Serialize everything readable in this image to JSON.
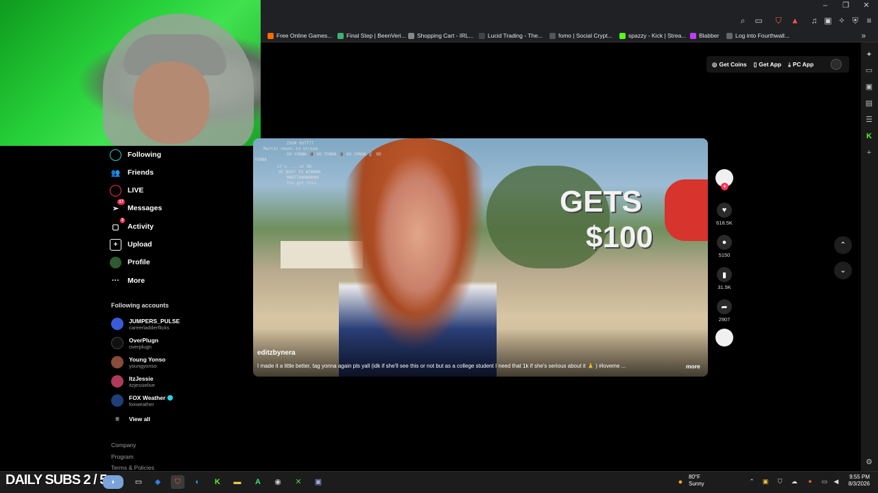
{
  "browser": {
    "bookmarks": [
      {
        "label": "Free Online Games...",
        "color": "#ff6a00"
      },
      {
        "label": "Final Step | BeenVeri...",
        "color": "#3cb371"
      },
      {
        "label": "Shopping Cart - IRL...",
        "color": "#888888"
      },
      {
        "label": "Lucid Trading - The...",
        "color": "#444444"
      },
      {
        "label": "fomo | Social Crypt...",
        "color": "#222222"
      },
      {
        "label": "spazzy - Kick | Strea...",
        "color": "#53fc18"
      },
      {
        "label": "Blabber",
        "color": "#c13cff"
      },
      {
        "label": "Log into Fourthwall...",
        "color": "#333333"
      }
    ]
  },
  "header": {
    "get_coins": "Get Coins",
    "get_app": "Get App",
    "pc_app": "PC App"
  },
  "sidebar": {
    "items": [
      {
        "label": "Following",
        "icon": "following-icon"
      },
      {
        "label": "Friends",
        "icon": "friends-icon"
      },
      {
        "label": "LIVE",
        "icon": "live-icon"
      },
      {
        "label": "Messages",
        "icon": "messages-icon",
        "badge": "17"
      },
      {
        "label": "Activity",
        "icon": "activity-icon",
        "badge": "3"
      },
      {
        "label": "Upload",
        "icon": "upload-icon"
      },
      {
        "label": "Profile",
        "icon": "profile-icon"
      },
      {
        "label": "More",
        "icon": "more-icon"
      }
    ],
    "following_title": "Following accounts",
    "accounts": [
      {
        "name": "JUMPERS_PULSE",
        "handle": "careerladderflicks",
        "color": "#3a5bd9"
      },
      {
        "name": "OverPlugn",
        "handle": "overplugn",
        "color": "#111111"
      },
      {
        "name": "Young Yonso",
        "handle": "youngyonso",
        "color": "#8a4b3b"
      },
      {
        "name": "ItzJessie",
        "handle": "itzjessielive",
        "color": "#b03a5a"
      },
      {
        "name": "FOX Weather",
        "handle": "foxweather",
        "color": "#1f3f7a",
        "verified": true
      }
    ],
    "view_all": "View all",
    "footer": [
      "Company",
      "Program",
      "Terms & Policies"
    ]
  },
  "video": {
    "overlay_line1": "GETS",
    "overlay_line2": "$100",
    "chat": [
      "ZOOM OUTTTT",
      "Martin needs to stream",
      "GO YONNA 🗿 GO YONNA 🗿 GO YONNA 🗿 GO",
      "YONNA",
      "it's ... ur GK",
      "OF BOUT TO WINNNN",
      "MARTINNNNNNNN",
      "You got this"
    ],
    "author": "editzbynera",
    "caption": "I made it a little better, tag yonna again pls yall (idk if she'll see this or not but as a college student I need that 1k if she's serious about it 🙏 ) #loveme ...",
    "more": "more"
  },
  "actions": {
    "likes": "618.5K",
    "comments": "5150",
    "saves": "31.5K",
    "shares": "2907"
  },
  "taskbar": {
    "subs_text": "DAILY SUBS 2 / 5",
    "temp": "80°F",
    "weather": "Sunny",
    "time": "9:55 PM",
    "date": "8/3/2026"
  }
}
